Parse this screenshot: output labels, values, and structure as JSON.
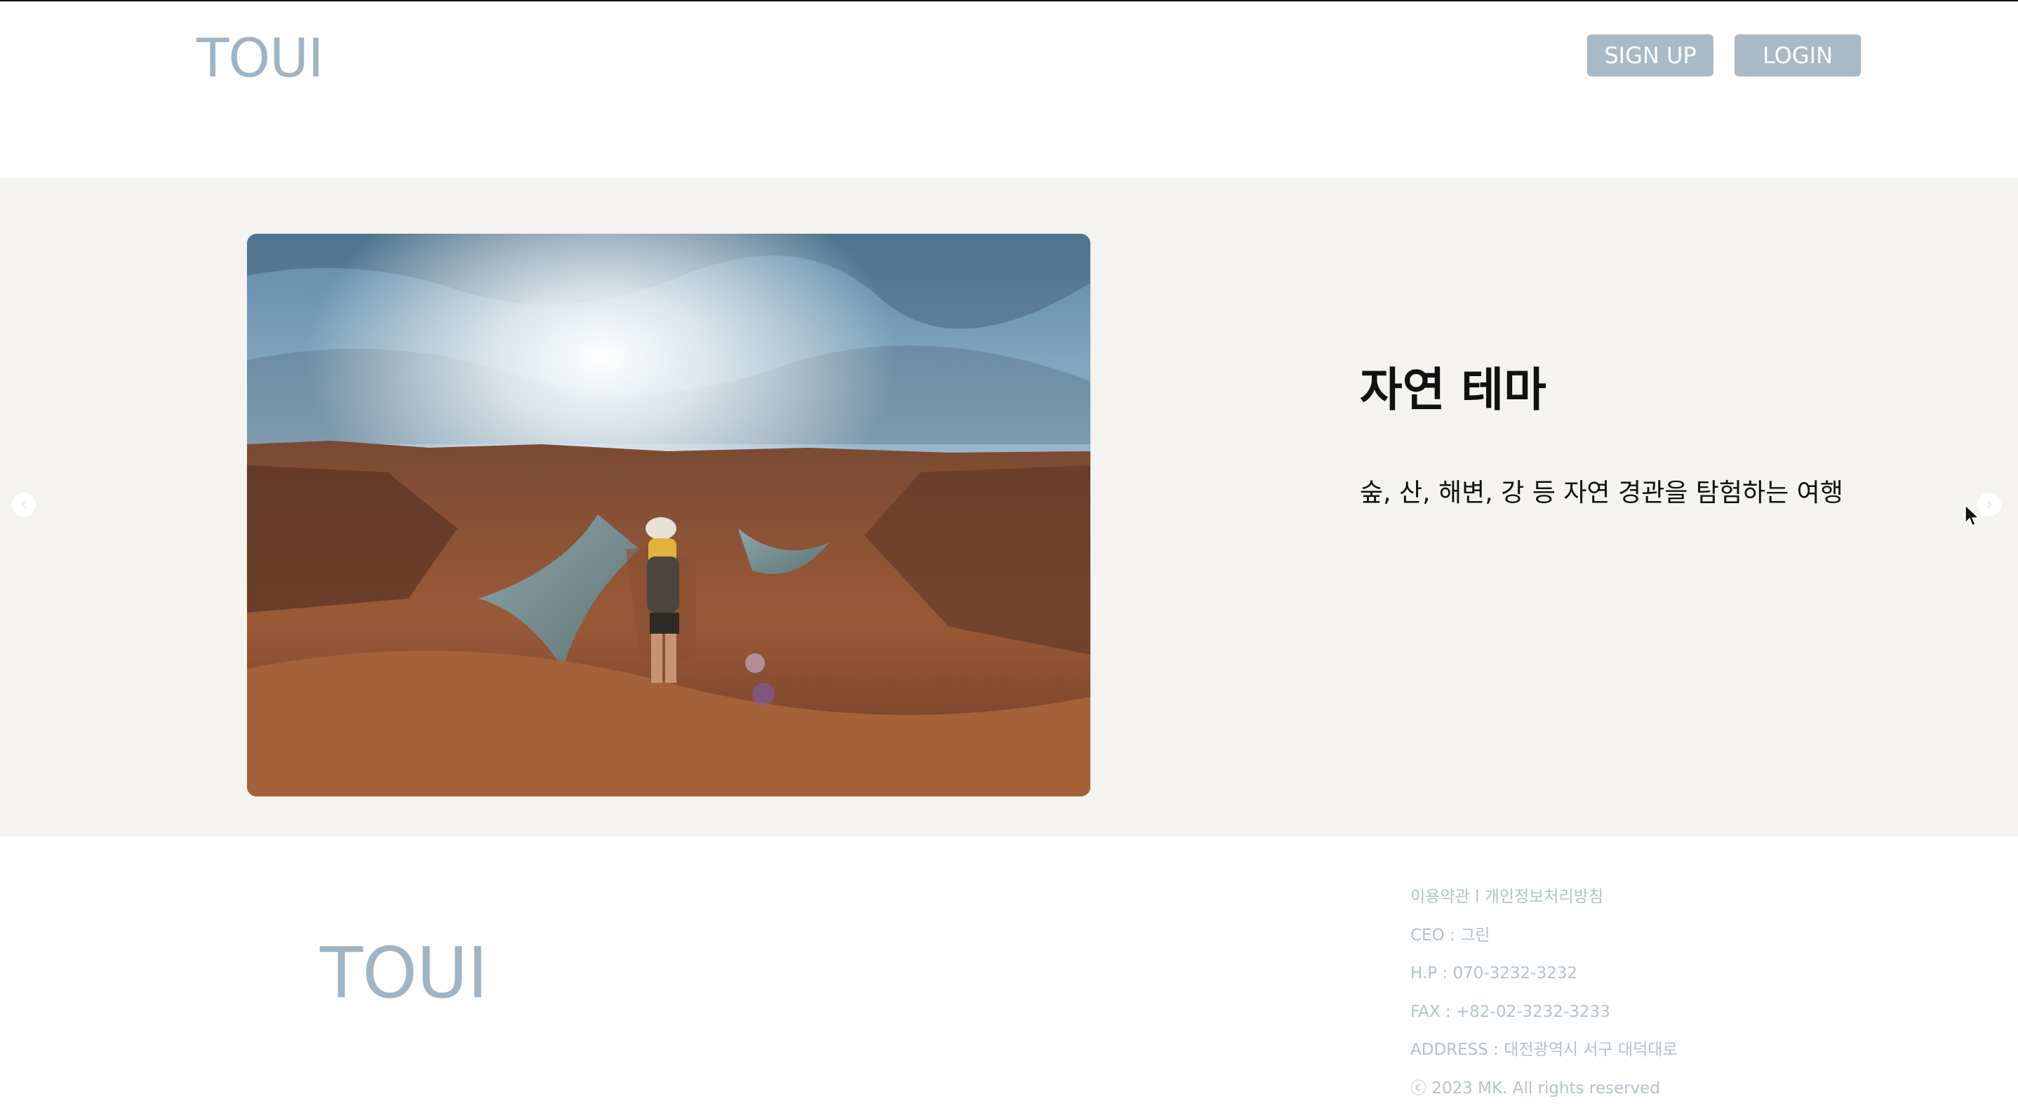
{
  "header": {
    "logo": "TOUI",
    "signup_label": "SIGN UP",
    "login_label": "LOGIN"
  },
  "hero": {
    "title": "자연 테마",
    "description": "숲, 산, 해변, 강 등 자연 경관을 탐험하는 여행",
    "prev_arrow": "‹",
    "next_arrow": "›"
  },
  "footer": {
    "logo": "TOUI",
    "terms_link": "이용약관",
    "separator": " l ",
    "privacy_link": "개인정보처리방침",
    "ceo": "CEO : 그린",
    "phone": "H.P : 070-3232-3232",
    "fax": "FAX : +82-02-3232-3233",
    "address": "ADDRESS : 대전광역시 서구 대덕대로",
    "copyright": "ⓒ 2023 MK. All rights reserved"
  },
  "colors": {
    "accent": "#a9bac6",
    "logo": "#9fb4c3",
    "hero_background": "#f4f3ef",
    "footer_text": "#b3c2cd"
  },
  "icons": {
    "prev": "chevron-left-icon",
    "next": "chevron-right-icon",
    "cursor": "mouse-pointer-icon"
  }
}
